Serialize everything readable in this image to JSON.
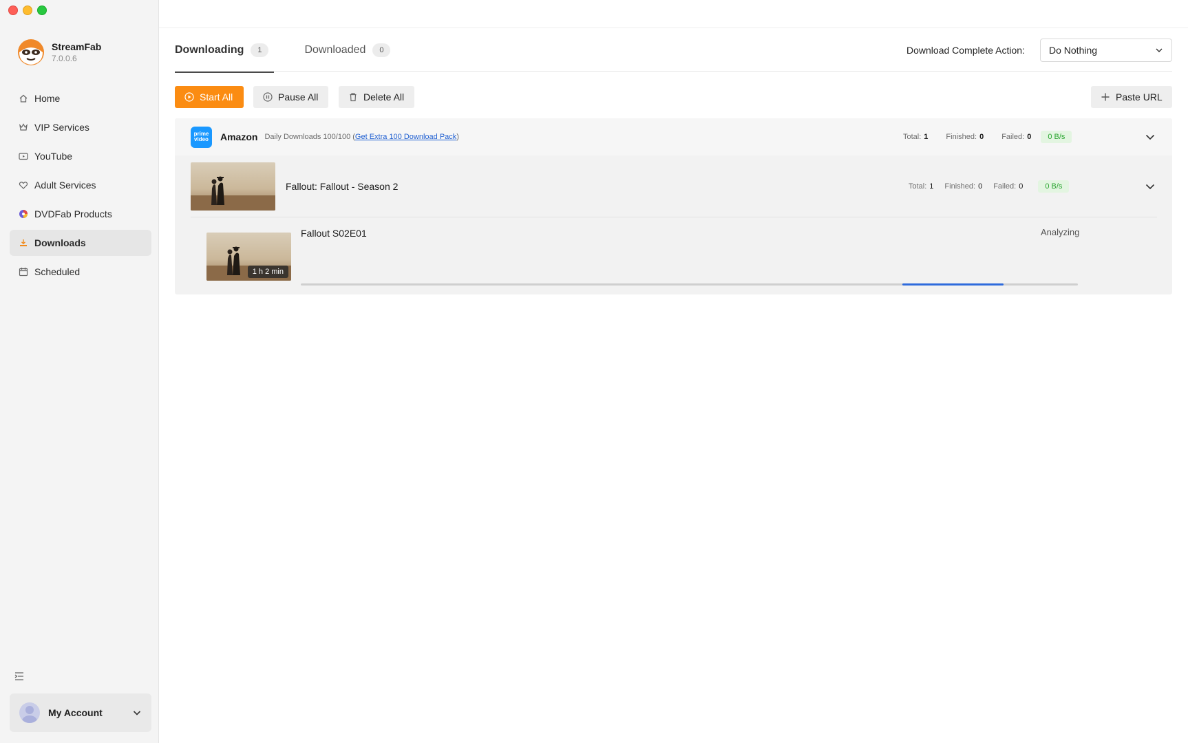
{
  "app": {
    "name": "StreamFab",
    "version": "7.0.0.6"
  },
  "sidebar": {
    "items": [
      {
        "label": "Home",
        "icon": "home-icon"
      },
      {
        "label": "VIP Services",
        "icon": "vip-icon"
      },
      {
        "label": "YouTube",
        "icon": "youtube-icon"
      },
      {
        "label": "Adult Services",
        "icon": "heart-icon"
      },
      {
        "label": "DVDFab Products",
        "icon": "dvdfab-icon"
      },
      {
        "label": "Downloads",
        "icon": "download-icon",
        "active": true
      },
      {
        "label": "Scheduled",
        "icon": "calendar-icon"
      }
    ],
    "account_label": "My Account"
  },
  "tabs": [
    {
      "label": "Downloading",
      "count": "1",
      "active": true
    },
    {
      "label": "Downloaded",
      "count": "0",
      "active": false
    }
  ],
  "complete_action": {
    "label": "Download Complete Action:",
    "value": "Do Nothing"
  },
  "toolbar": {
    "start_all": "Start All",
    "pause_all": "Pause All",
    "delete_all": "Delete All",
    "paste_url": "Paste URL"
  },
  "group": {
    "service": "Amazon",
    "logo_text_1": "prime",
    "logo_text_2": "video",
    "daily_prefix": "Daily Downloads 100/100 (",
    "daily_link": "Get Extra 100 Download Pack",
    "daily_suffix": ")",
    "total_label": "Total:",
    "total": "1",
    "finished_label": "Finished:",
    "finished": "0",
    "failed_label": "Failed:",
    "failed": "0",
    "speed": "0 B/s"
  },
  "season": {
    "title": "Fallout: Fallout - Season 2",
    "total_label": "Total:",
    "total": "1",
    "finished_label": "Finished:",
    "finished": "0",
    "failed_label": "Failed:",
    "failed": "0",
    "speed": "0 B/s"
  },
  "episode": {
    "title": "Fallout S02E01",
    "duration": "1 h 2 min",
    "status": "Analyzing",
    "progress_start": 0.774,
    "progress_end": 0.904
  },
  "colors": {
    "accent": "#fb8c12",
    "progress": "#2f6bdc",
    "link": "#1f5fd1",
    "speed_text": "#2aa530",
    "prime_blue": "#1a98ff"
  }
}
